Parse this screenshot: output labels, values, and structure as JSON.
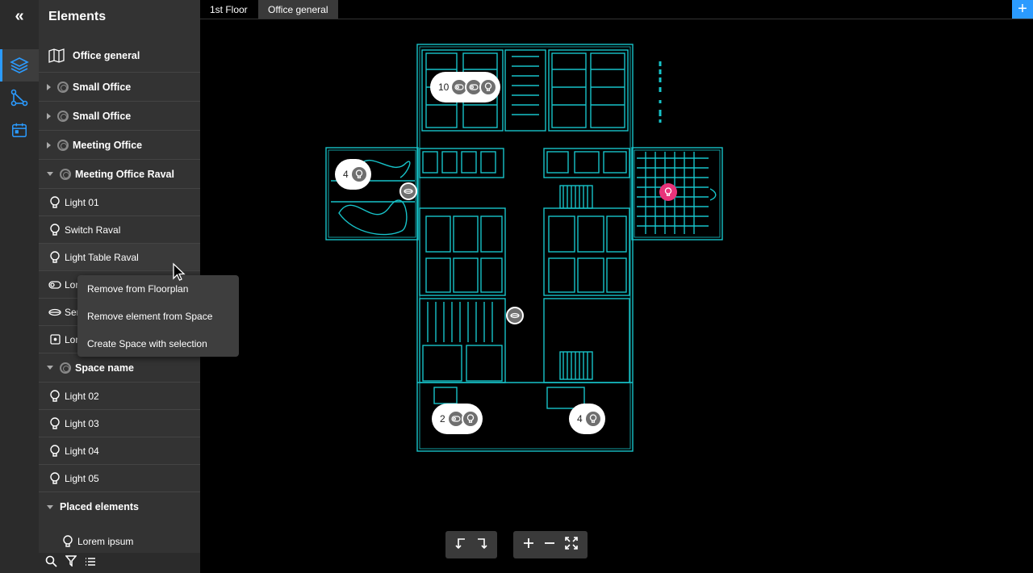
{
  "panel": {
    "title": "Elements",
    "map_item": "Office general",
    "groups": [
      {
        "label": "Small Office"
      },
      {
        "label": "Small Office"
      },
      {
        "label": "Meeting Office"
      },
      {
        "label": "Meeting Office Raval"
      }
    ],
    "raval_items": [
      {
        "label": "Light 01",
        "icon": "bulb-icon"
      },
      {
        "label": "Switch Raval",
        "icon": "bulb-icon"
      },
      {
        "label": "Light Table Raval",
        "icon": "bulb-icon"
      },
      {
        "label": "Lor",
        "icon": "toggle-icon"
      },
      {
        "label": "Ser",
        "icon": "sensor-icon"
      },
      {
        "label": "Lor",
        "icon": "socket-icon"
      }
    ],
    "space_group": "Space name",
    "space_items": [
      {
        "label": "Light 02"
      },
      {
        "label": "Light 03"
      },
      {
        "label": "Light 04"
      },
      {
        "label": "Light 05"
      }
    ],
    "placed_group": "Placed elements",
    "placed_items": [
      {
        "label": "Lorem ipsum"
      }
    ]
  },
  "context_menu": {
    "items": [
      "Remove from Floorplan",
      "Remove element from Space",
      "Create Space with selection"
    ]
  },
  "tabs": [
    {
      "label": "1st Floor",
      "active": false
    },
    {
      "label": "Office general",
      "active": true
    }
  ],
  "add_tab": "+",
  "clusters": [
    {
      "count": "10",
      "devices": [
        "toggle-icon",
        "toggle-icon",
        "bulb-icon"
      ]
    },
    {
      "count": "4",
      "devices": [
        "bulb-icon"
      ]
    },
    {
      "count": "2",
      "devices": [
        "toggle-icon",
        "bulb-icon"
      ]
    },
    {
      "count": "4",
      "devices": [
        "bulb-icon"
      ]
    }
  ],
  "colors": {
    "accent": "#2b9bff",
    "floorplan": "#17c3c9",
    "selected_pin": "#e8337a",
    "panel": "#333333",
    "rail": "#2b2b2b"
  }
}
